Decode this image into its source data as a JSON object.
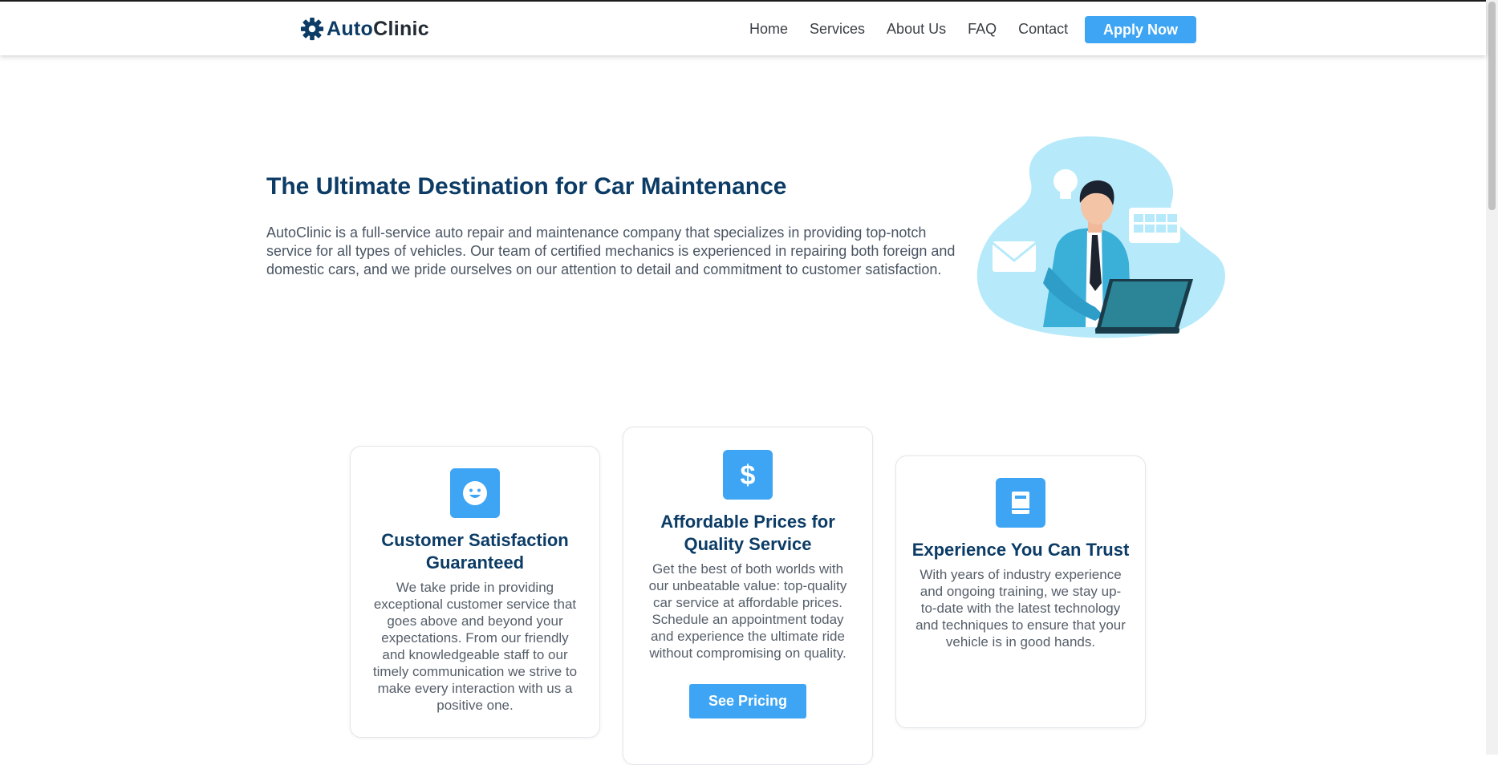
{
  "nav": {
    "brand_part1": "Auto",
    "brand_part2": "Clinic",
    "links": [
      "Home",
      "Services",
      "About Us",
      "FAQ",
      "Contact"
    ],
    "cta_label": "Apply Now"
  },
  "hero": {
    "title": "The Ultimate Destination for Car Maintenance",
    "description": "AutoClinic is a full-service auto repair and maintenance company that specializes in providing top-notch service for all types of vehicles. Our team of certified mechanics is experienced in repairing both foreign and domestic cars, and we pride ourselves on our attention to detail and commitment to customer satisfaction."
  },
  "features": [
    {
      "icon": "smile-icon",
      "title": "Customer Satisfaction Guaranteed",
      "text": "We take pride in providing exceptional customer service that goes above and beyond your expectations. From our friendly and knowledgeable staff to our timely communication we strive to make every interaction with us a positive one."
    },
    {
      "icon": "dollar-icon",
      "title": "Affordable Prices for Quality Service",
      "text": "Get the best of both worlds with our unbeatable value: top-quality car service at affordable prices. Schedule an appointment today and experience the ultimate ride without compromising on quality.",
      "button_label": "See Pricing"
    },
    {
      "icon": "book-icon",
      "title": "Experience You Can Trust",
      "text": "With years of industry experience and ongoing training, we stay up-to-date with the latest technology and techniques to ensure that your vehicle is in good hands."
    }
  ],
  "colors": {
    "accent": "#3da5f4",
    "navy": "#0c3c66",
    "text": "#4a5563"
  }
}
